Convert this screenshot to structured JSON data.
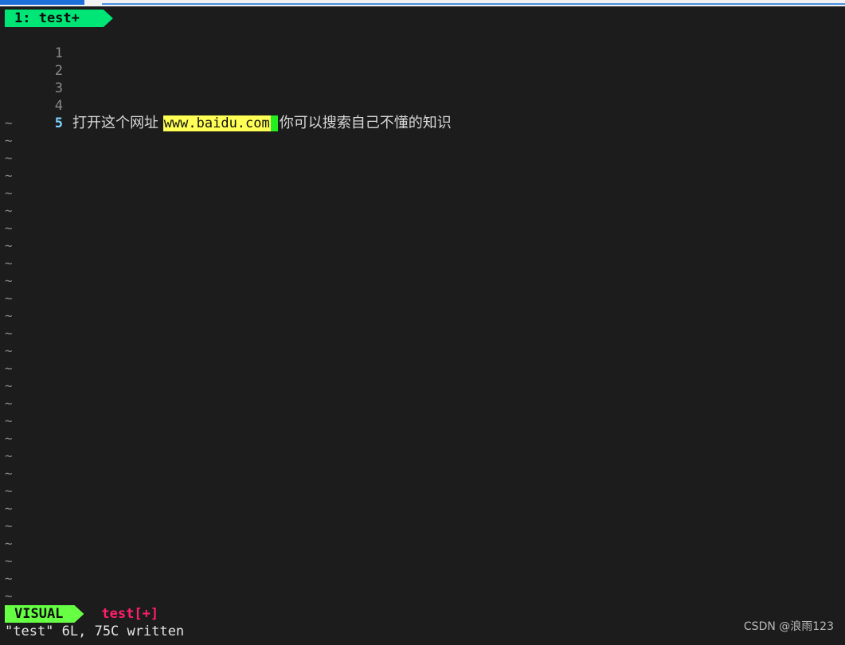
{
  "tabline": {
    "tab_label": "1: test+"
  },
  "editor": {
    "lines": [
      {
        "num": "1",
        "text": ""
      },
      {
        "num": "2",
        "text": ""
      },
      {
        "num": "3",
        "text": ""
      },
      {
        "num": "4",
        "text": ""
      },
      {
        "num": "5",
        "before": "打开这个网址 ",
        "highlight": "www.baidu.com",
        "after": "你可以搜索自己不懂的知识"
      }
    ],
    "tilde": "~"
  },
  "statusline": {
    "mode": "VISUAL",
    "filename": "test[+]"
  },
  "message": "\"test\" 6L, 75C written",
  "watermark": "CSDN @浪雨123",
  "colors": {
    "background": "#1c1c1c",
    "tab": "#00e676",
    "mode": "#66ff44",
    "highlight": "#ffff55",
    "filename": "#ff1f6b"
  }
}
